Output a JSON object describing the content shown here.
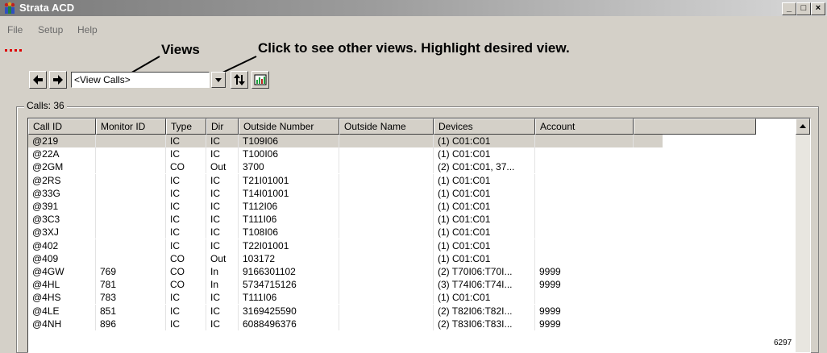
{
  "window": {
    "title": "Strata ACD",
    "minimize": "_",
    "maximize": "□",
    "close": "×"
  },
  "menu": {
    "items": [
      "File",
      "Setup",
      "Help"
    ]
  },
  "callouts": {
    "views": "Views",
    "instructions": "Click to see other views. Highlight desired view."
  },
  "toolbar": {
    "view_select_value": "<View Calls>"
  },
  "group": {
    "label": "Calls: 36"
  },
  "table": {
    "columns": [
      "Call ID",
      "Monitor ID",
      "Type",
      "Dir",
      "Outside Number",
      "Outside Name",
      "Devices",
      "Account"
    ],
    "rows": [
      [
        "@219",
        "",
        "IC",
        "IC",
        "T109I06",
        "",
        "(1) C01:C01",
        ""
      ],
      [
        "@22A",
        "",
        "IC",
        "IC",
        "T100I06",
        "",
        "(1) C01:C01",
        ""
      ],
      [
        "@2GM",
        "",
        "CO",
        "Out",
        "3700",
        "",
        "(2) C01:C01, 37...",
        ""
      ],
      [
        "@2RS",
        "",
        "IC",
        "IC",
        "T21I01001",
        "",
        "(1) C01:C01",
        ""
      ],
      [
        "@33G",
        "",
        "IC",
        "IC",
        "T14I01001",
        "",
        "(1) C01:C01",
        ""
      ],
      [
        "@391",
        "",
        "IC",
        "IC",
        "T112I06",
        "",
        "(1) C01:C01",
        ""
      ],
      [
        "@3C3",
        "",
        "IC",
        "IC",
        "T111I06",
        "",
        "(1) C01:C01",
        ""
      ],
      [
        "@3XJ",
        "",
        "IC",
        "IC",
        "T108I06",
        "",
        "(1) C01:C01",
        ""
      ],
      [
        "@402",
        "",
        "IC",
        "IC",
        "T22I01001",
        "",
        "(1) C01:C01",
        ""
      ],
      [
        "@409",
        "",
        "CO",
        "Out",
        "103172",
        "",
        "(1) C01:C01",
        ""
      ],
      [
        "@4GW",
        "769",
        "CO",
        "In",
        "9166301102",
        "",
        "(2) T70I06:T70I...",
        "9999"
      ],
      [
        "@4HL",
        "781",
        "CO",
        "In",
        "5734715126",
        "",
        "(3) T74I06:T74I...",
        "9999"
      ],
      [
        "@4HS",
        "783",
        "IC",
        "IC",
        "T111I06",
        "",
        "(1) C01:C01",
        ""
      ],
      [
        "@4LE",
        "851",
        "IC",
        "IC",
        "3169425590",
        "",
        "(2) T82I06:T82I...",
        "9999"
      ],
      [
        "@4NH",
        "896",
        "IC",
        "IC",
        "6088496376",
        "",
        "(2) T83I06:T83I...",
        "9999"
      ]
    ]
  },
  "figure_ref": "6297",
  "colors": {
    "window_bg": "#d4d0c8",
    "selected_row": "#d4d0c8",
    "menu_marker": "#dd0000"
  }
}
